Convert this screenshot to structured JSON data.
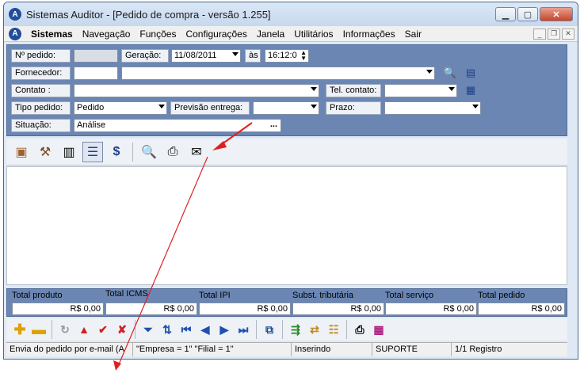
{
  "window": {
    "title": "Sistemas Auditor - [Pedido de compra - versão 1.255]"
  },
  "menu": {
    "items": [
      "Sistemas",
      "Navegação",
      "Funções",
      "Configurações",
      "Janela",
      "Utilitários",
      "Informações",
      "Sair"
    ]
  },
  "form": {
    "pedido_label": "Nº pedido:",
    "geracao_label": "Geração:",
    "geracao_date": "11/08/2011",
    "as_label": "às",
    "geracao_time": "16:12:0",
    "fornecedor_label": "Fornecedor:",
    "contato_label": "Contato :",
    "tel_label": "Tel. contato:",
    "tipo_label": "Tipo pedido:",
    "tipo_value": "Pedido",
    "previsao_label": "Previsão entrega:",
    "prazo_label": "Prazo:",
    "situacao_label": "Situação:",
    "situacao_value": "Análise",
    "ellipsis": "..."
  },
  "totals": [
    {
      "label": "Total produto",
      "value": "R$ 0,00"
    },
    {
      "label": "Total ICMS",
      "value": "R$ 0,00"
    },
    {
      "label": "Total IPI",
      "value": "R$ 0,00"
    },
    {
      "label": "Subst. tributária",
      "value": "R$ 0,00"
    },
    {
      "label": "Total serviço",
      "value": "R$ 0,00"
    },
    {
      "label": "Total pedido",
      "value": "R$ 0,00"
    }
  ],
  "status": {
    "hint": "Envia do pedido por e-mail (A",
    "filter": "\"Empresa = 1\"   \"Filial = 1\"",
    "mode": "Inserindo",
    "user": "SUPORTE",
    "records": "1/1 Registro"
  },
  "colors": {
    "panel": "#6b86b3",
    "arrow": "#e02020",
    "accent_red": "#cc2222"
  }
}
